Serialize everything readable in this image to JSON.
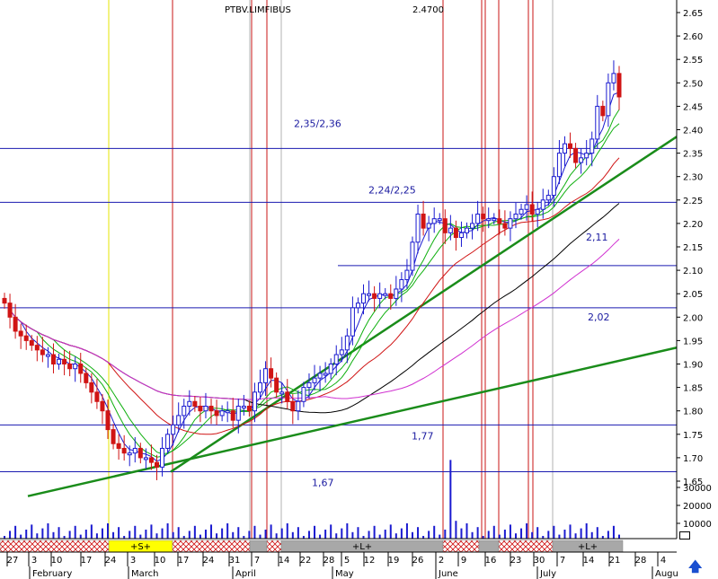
{
  "chart_data": {
    "type": "candlestick",
    "title": "PTBV.LIMFIBUS",
    "title_value": "2.4700",
    "y_ticks": [
      "2.65",
      "2.60",
      "2.55",
      "2.50",
      "2.45",
      "2.40",
      "2.35",
      "2.30",
      "2.25",
      "2.20",
      "2.15",
      "2.10",
      "2.05",
      "2.00",
      "1.95",
      "1.90",
      "1.85",
      "1.80",
      "1.75",
      "1.70",
      "1.65"
    ],
    "ylim": [
      1.62,
      2.67
    ],
    "volume_ticks": [
      "30000",
      "20000",
      "10000"
    ],
    "x_day_labels": [
      "27",
      "3",
      "10",
      "17",
      "24",
      "3",
      "10",
      "17",
      "24",
      "31",
      "7",
      "14",
      "22",
      "28",
      "5",
      "12",
      "19",
      "26",
      "2",
      "9",
      "16",
      "23",
      "30",
      "7",
      "14",
      "21",
      "28",
      "4"
    ],
    "x_month_labels": [
      "February",
      "March",
      "April",
      "May",
      "June",
      "July",
      "Augu"
    ],
    "annotations": [
      {
        "label": "2,35/2,36",
        "value": 2.36
      },
      {
        "label": "2,24/2,25",
        "value": 2.245
      },
      {
        "label": "2,11",
        "value": 2.11
      },
      {
        "label": "2,02",
        "value": 2.02
      },
      {
        "label": "1,77",
        "value": 1.77
      },
      {
        "label": "1,67",
        "value": 1.67
      }
    ],
    "support_levels": [
      2.36,
      2.245,
      2.11,
      2.02,
      1.77,
      1.67
    ],
    "period_labels": [
      "+S+",
      "+L+",
      "+L+"
    ],
    "close_series": [
      2.03,
      2.0,
      1.97,
      1.96,
      1.95,
      1.94,
      1.93,
      1.92,
      1.92,
      1.9,
      1.91,
      1.9,
      1.89,
      1.9,
      1.88,
      1.86,
      1.84,
      1.82,
      1.8,
      1.76,
      1.73,
      1.72,
      1.71,
      1.71,
      1.72,
      1.7,
      1.7,
      1.69,
      1.68,
      1.72,
      1.75,
      1.77,
      1.79,
      1.81,
      1.82,
      1.81,
      1.8,
      1.81,
      1.8,
      1.79,
      1.8,
      1.8,
      1.78,
      1.81,
      1.81,
      1.8,
      1.84,
      1.86,
      1.89,
      1.87,
      1.84,
      1.84,
      1.82,
      1.8,
      1.82,
      1.85,
      1.86,
      1.87,
      1.88,
      1.88,
      1.9,
      1.92,
      1.93,
      1.96,
      2.02,
      2.03,
      2.05,
      2.05,
      2.04,
      2.05,
      2.05,
      2.04,
      2.06,
      2.08,
      2.1,
      2.16,
      2.22,
      2.19,
      2.2,
      2.21,
      2.21,
      2.18,
      2.19,
      2.17,
      2.18,
      2.19,
      2.2,
      2.22,
      2.21,
      2.21,
      2.21,
      2.2,
      2.19,
      2.21,
      2.22,
      2.23,
      2.24,
      2.22,
      2.23,
      2.25,
      2.26,
      2.3,
      2.35,
      2.37,
      2.36,
      2.33,
      2.34,
      2.35,
      2.38,
      2.45,
      2.43,
      2.5,
      2.52,
      2.47
    ]
  },
  "colors": {
    "grid_line": "#1a1ab0",
    "event_red": "#c81414",
    "event_yellow": "#e6e600",
    "trend": "#1a8c1a",
    "up_candle": "#1a1ad0",
    "down_candle": "#d01414",
    "ma_black": "#000000",
    "ma_magenta": "#d030d0",
    "ma_red": "#d01414",
    "ma_blue": "#1a1ad0",
    "ma_green": "#10b010",
    "period_gray": "#a8a8a8",
    "period_yellow": "#ffff00"
  },
  "icons": {
    "scroll": "scroll-up-arrow-icon",
    "scroll_box": "scroll-box-icon"
  },
  "scroll_arrow": "🡅"
}
